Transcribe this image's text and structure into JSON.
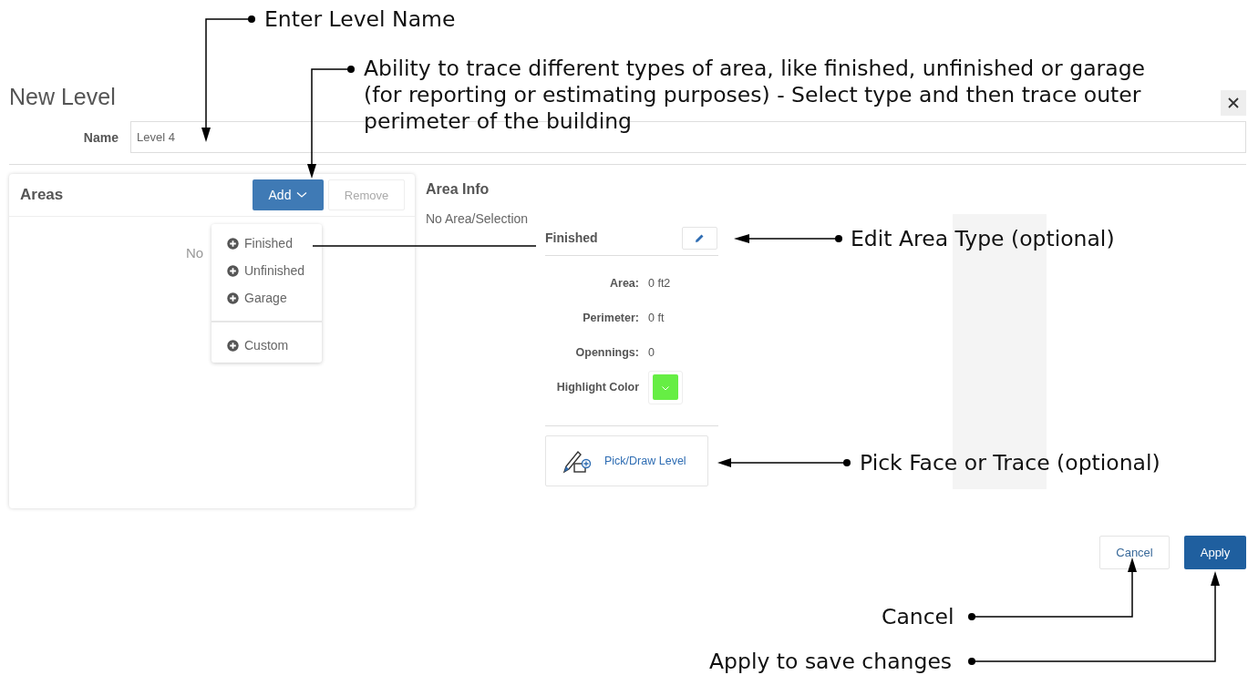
{
  "dialog": {
    "title": "New Level"
  },
  "name_field": {
    "label": "Name",
    "value": "Level 4"
  },
  "areas": {
    "title": "Areas",
    "add_button": "Add",
    "remove_button": {
      "label": "Remove",
      "disabled": true
    },
    "empty_text": "No",
    "menu_groups": [
      [
        "Finished",
        "Unfinished",
        "Garage"
      ],
      [
        "Custom"
      ]
    ]
  },
  "area_info": {
    "title": "Area Info",
    "empty_text": "No Area/Selection",
    "area_type": "Finished",
    "fields": [
      {
        "label": "Area:",
        "value": "0 ft2"
      },
      {
        "label": "Perimeter:",
        "value": "0 ft"
      },
      {
        "label": "Opennings:",
        "value": "0"
      }
    ],
    "highlight": {
      "label": "Highlight Color",
      "color": "#66ee44"
    },
    "pick_button": "Pick/Draw Level"
  },
  "footer": {
    "cancel": "Cancel",
    "apply": "Apply"
  },
  "annotations": [
    "Enter Level Name",
    "Ability to trace different types of area, like finished, unfinished or garage (for reporting or estimating purposes) - Select type and then trace outer perimeter of the building",
    "Edit Area Type (optional)",
    "Pick Face or Trace (optional)",
    "Cancel",
    "Apply to save changes"
  ]
}
